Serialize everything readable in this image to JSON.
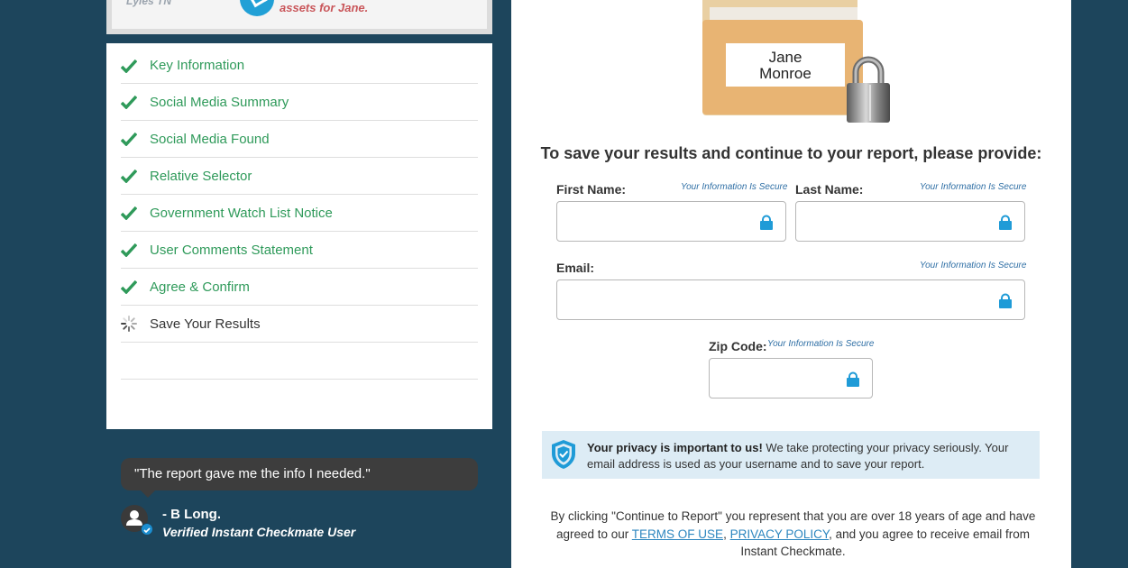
{
  "top_card": {
    "location": "Lyles TN",
    "message": "assets for Jane."
  },
  "checklist": {
    "items": [
      {
        "label": "Key Information",
        "status": "complete"
      },
      {
        "label": "Social Media Summary",
        "status": "complete"
      },
      {
        "label": "Social Media Found",
        "status": "complete"
      },
      {
        "label": "Relative Selector",
        "status": "complete"
      },
      {
        "label": "Government Watch List Notice",
        "status": "complete"
      },
      {
        "label": "User Comments Statement",
        "status": "complete"
      },
      {
        "label": "Agree & Confirm",
        "status": "complete"
      },
      {
        "label": "Save Your Results",
        "status": "loading"
      }
    ]
  },
  "testimonial": {
    "quote": "\"The report gave me the info I needed.\"",
    "author": "- B Long.",
    "role": "Verified Instant Checkmate User"
  },
  "folder": {
    "first_name": "Jane",
    "last_name": "Monroe"
  },
  "form": {
    "heading": "To save your results and continue to your report, please provide:",
    "secure_note": "Your Information Is Secure",
    "first_name": {
      "label": "First Name:",
      "value": ""
    },
    "last_name": {
      "label": "Last Name:",
      "value": ""
    },
    "email": {
      "label": "Email:",
      "value": ""
    },
    "zip": {
      "label": "Zip Code:",
      "value": ""
    }
  },
  "privacy": {
    "bold": "Your privacy is important to us!",
    "text": " We take protecting your privacy seriously. Your email address is used as your username and to save your report."
  },
  "disclaimer": {
    "part1": "By clicking \"Continue to Report\" you represent that you are over 18 years of age and have agreed to our ",
    "terms_link": "TERMS OF USE",
    "sep": ", ",
    "privacy_link": "PRIVACY POLICY",
    "part2": ", and you agree to receive email from Instant Checkmate."
  },
  "colors": {
    "background": "#1d455c",
    "check_green": "#2f9a5a",
    "accent_blue": "#21a0d6",
    "link_blue": "#2c86bf",
    "privacy_bg": "#ddecf5"
  }
}
